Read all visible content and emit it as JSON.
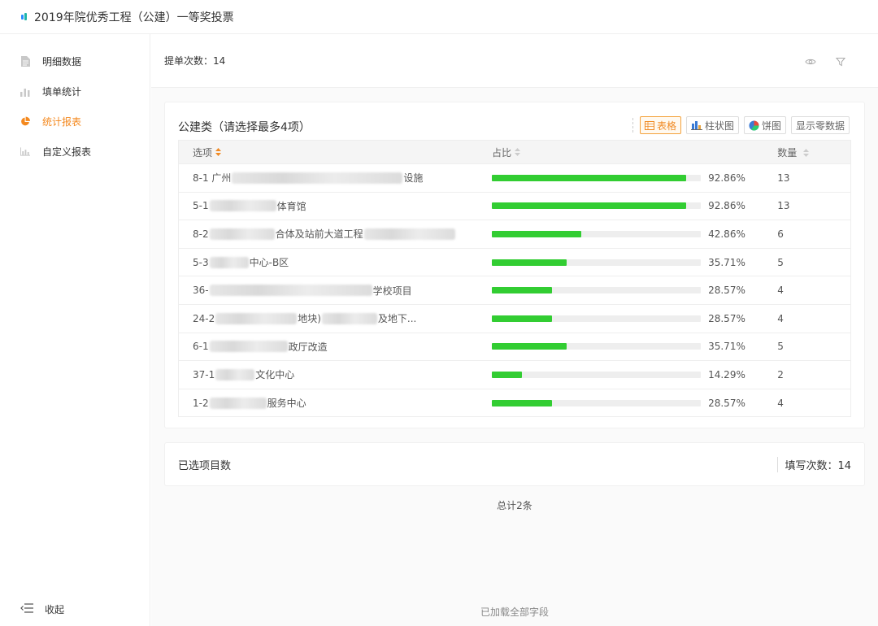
{
  "app": {
    "title": "2019年院优秀工程（公建）一等奖投票"
  },
  "sidebar": {
    "items": [
      {
        "label": "明细数据",
        "icon": "document-icon"
      },
      {
        "label": "填单统计",
        "icon": "bar-chart-icon"
      },
      {
        "label": "统计报表",
        "icon": "pie-chart-icon",
        "active": true
      },
      {
        "label": "自定义报表",
        "icon": "custom-chart-icon"
      }
    ],
    "collapse_label": "收起"
  },
  "summary": {
    "text": "提单次数：14"
  },
  "card": {
    "title": "公建类（请选择最多4项）",
    "toolbar": {
      "table": "表格",
      "bar": "柱状图",
      "pie": "饼图",
      "zero": "显示零数据"
    },
    "columns": {
      "option": "选项",
      "ratio": "占比",
      "count": "数量"
    },
    "rows": [
      {
        "prefix": "8-1 广州",
        "suffix": "设施",
        "pct": "92.86%",
        "ratio": 0.9286,
        "count": "13"
      },
      {
        "prefix": "5-1",
        "suffix": "体育馆",
        "pct": "92.86%",
        "ratio": 0.9286,
        "count": "13"
      },
      {
        "prefix": "8-2",
        "suffix": "合体及站前大道工程",
        "pct": "42.86%",
        "ratio": 0.4286,
        "count": "6"
      },
      {
        "prefix": "5-3",
        "suffix": "中心-B区",
        "pct": "35.71%",
        "ratio": 0.3571,
        "count": "5"
      },
      {
        "prefix": "36-",
        "suffix": "学校项目",
        "pct": "28.57%",
        "ratio": 0.2857,
        "count": "4"
      },
      {
        "prefix": "24-2",
        "suffix": "地块)",
        "suffix2": "及地下...",
        "pct": "28.57%",
        "ratio": 0.2857,
        "count": "4"
      },
      {
        "prefix": "6-1",
        "suffix": "政厅改造",
        "pct": "35.71%",
        "ratio": 0.3571,
        "count": "5"
      },
      {
        "prefix": "37-1",
        "suffix": "文化中心",
        "pct": "14.29%",
        "ratio": 0.1429,
        "count": "2"
      },
      {
        "prefix": "1-2",
        "suffix": "服务中心",
        "pct": "28.57%",
        "ratio": 0.2857,
        "count": "4"
      }
    ]
  },
  "selected_card": {
    "label": "已选项目数",
    "fill_count": "填写次数：14"
  },
  "footer": {
    "total": "总计2条",
    "loaded": "已加载全部字段"
  },
  "colors": {
    "accent": "#f4891f",
    "bar": "#32cd32"
  }
}
